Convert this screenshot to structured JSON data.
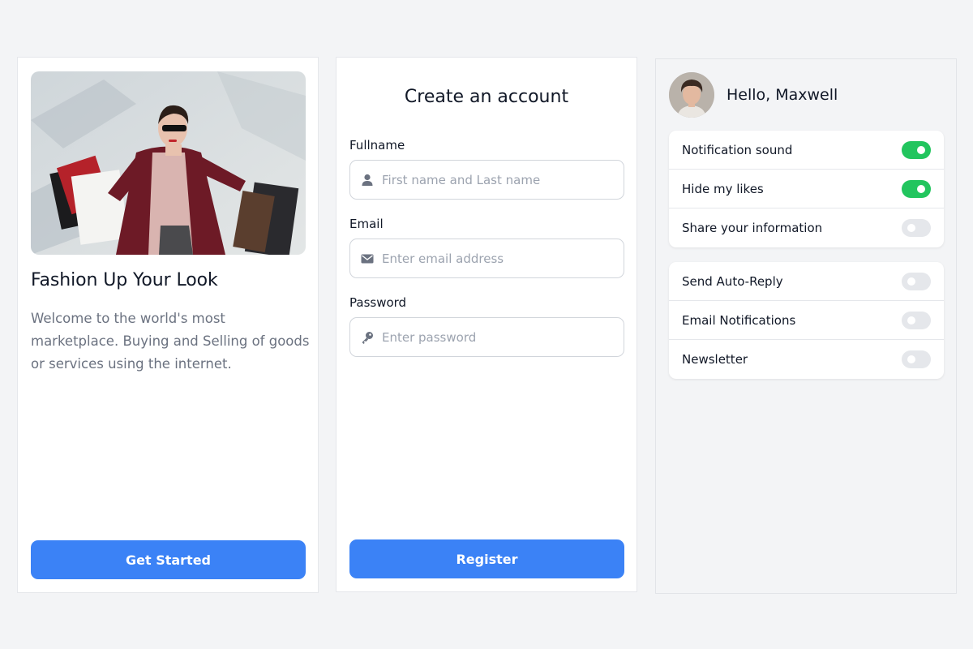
{
  "promo_card": {
    "title": "Fashion Up Your Look",
    "description": "Welcome to the world's most marketplace. Buying and Selling of goods or services using the internet.",
    "cta_label": "Get Started"
  },
  "register_card": {
    "title": "Create an account",
    "fields": [
      {
        "label": "Fullname",
        "placeholder": "First name and Last name",
        "value": "",
        "icon": "user-icon"
      },
      {
        "label": "Email",
        "placeholder": "Enter email address",
        "value": "",
        "icon": "envelope-icon"
      },
      {
        "label": "Password",
        "placeholder": "Enter password",
        "value": "",
        "icon": "key-icon"
      }
    ],
    "submit_label": "Register"
  },
  "settings_card": {
    "greeting": "Hello, Maxwell",
    "groups": [
      [
        {
          "label": "Notification sound",
          "enabled": true
        },
        {
          "label": "Hide my likes",
          "enabled": true
        },
        {
          "label": "Share your information",
          "enabled": false
        }
      ],
      [
        {
          "label": "Send Auto-Reply",
          "enabled": false
        },
        {
          "label": "Email Notifications",
          "enabled": false
        },
        {
          "label": "Newsletter",
          "enabled": false
        }
      ]
    ]
  },
  "colors": {
    "page_background": "#f3f4f6",
    "primary": "#3b82f6",
    "toggle_on": "#22c55e",
    "toggle_off": "#e5e7eb",
    "muted_text": "#6b7280"
  }
}
